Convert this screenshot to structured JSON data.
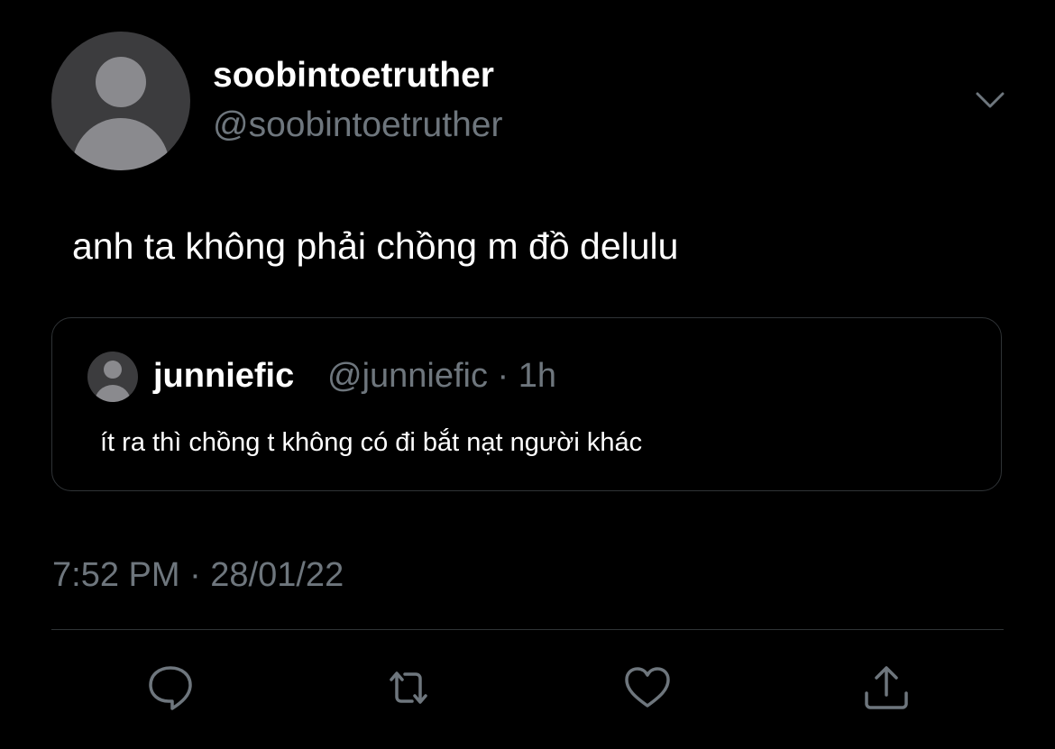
{
  "tweet": {
    "display_name": "soobintoetruther",
    "handle": "@soobintoetruther",
    "text": "anh ta không phải chồng m đồ delulu",
    "timestamp": "7:52 PM · 28/01/22"
  },
  "quoted_tweet": {
    "display_name": "junniefic",
    "meta": "@junniefic · 1h",
    "text": "ít ra thì chồng t không có đi bắt nạt người khác"
  },
  "actions": [
    {
      "icon": "reply-icon"
    },
    {
      "icon": "retweet-icon"
    },
    {
      "icon": "like-icon"
    },
    {
      "icon": "share-icon"
    }
  ],
  "colors": {
    "background": "#000000",
    "primary_text": "#ffffff",
    "secondary_text": "#6e767d",
    "border": "#2f3336",
    "avatar_bg": "#3c3c3e",
    "avatar_figure": "#8a8a8e",
    "icon": "#6e767d"
  }
}
